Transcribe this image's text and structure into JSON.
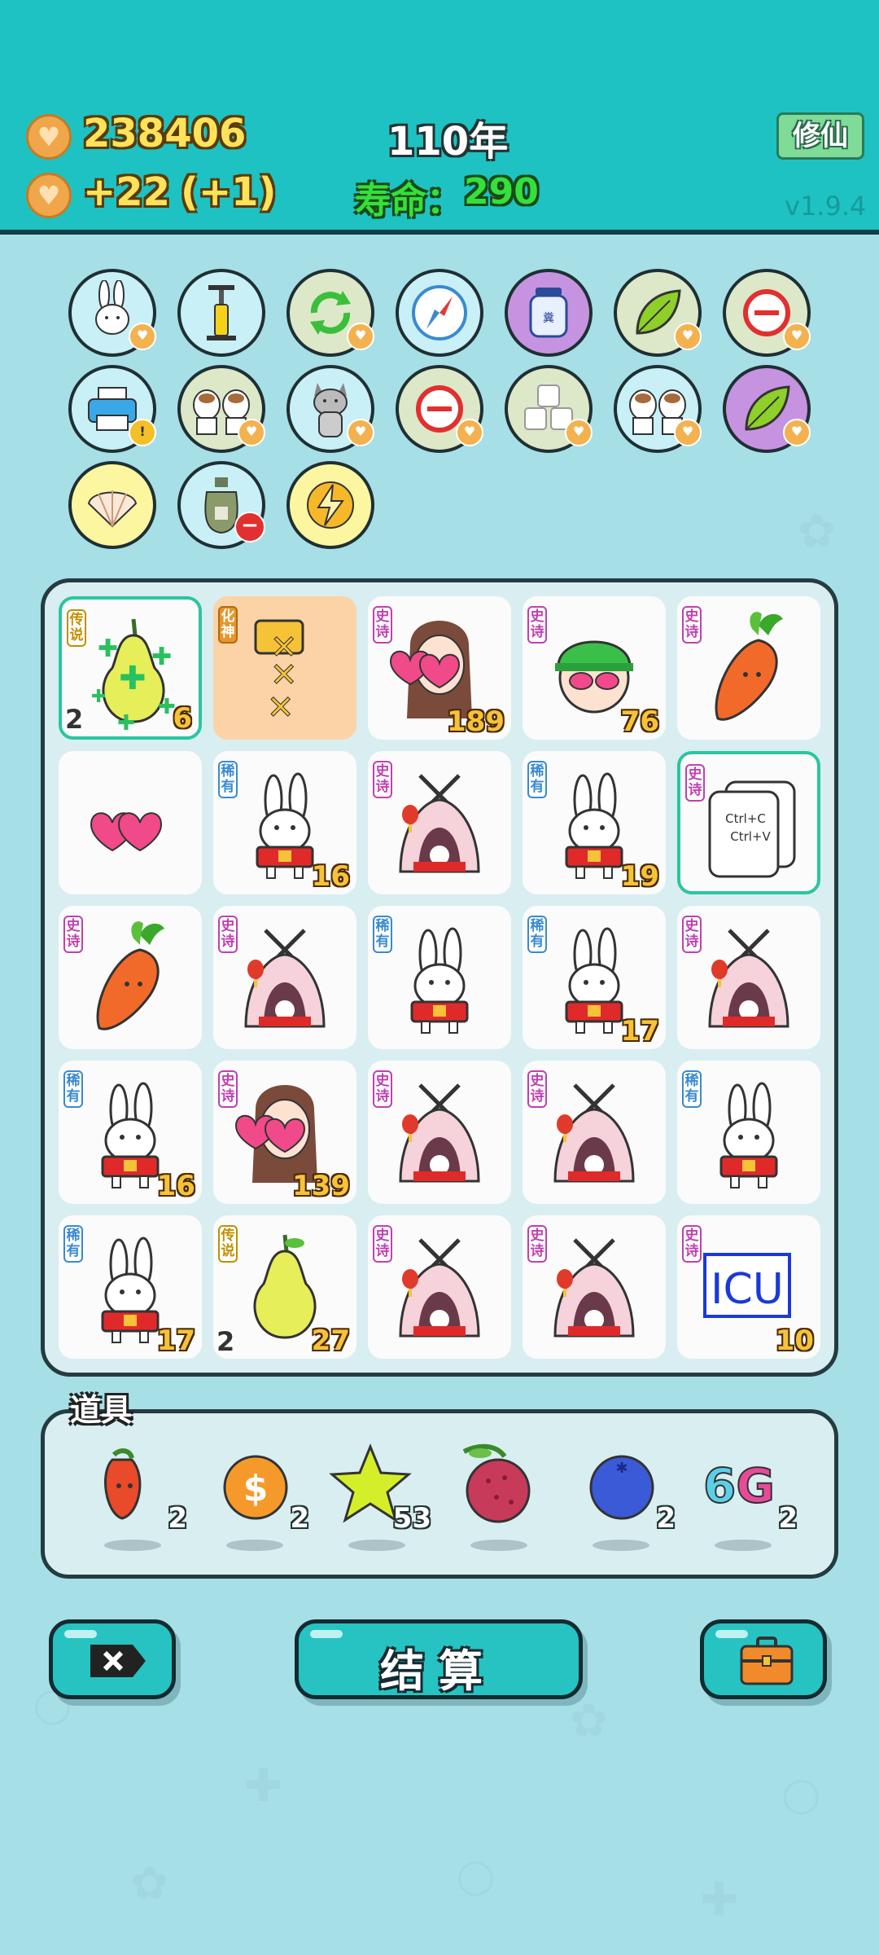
{
  "header": {
    "coins": "238406",
    "income": "+22",
    "income_bonus": "(+1)",
    "year": "110年",
    "lifespan_label": "寿命：",
    "lifespan_value": "290",
    "xiuxian_label": "修仙",
    "version": "v1.9.4"
  },
  "skills": [
    {
      "icon": "rabbit-icon"
    },
    {
      "icon": "air-pump-icon"
    },
    {
      "icon": "refresh-icon"
    },
    {
      "icon": "compass-icon"
    },
    {
      "icon": "jar-icon",
      "jar_label": "糞"
    },
    {
      "icon": "leaf-icon"
    },
    {
      "icon": "minus-circle-icon"
    },
    {
      "icon": "printer-icon"
    },
    {
      "icon": "two-cows-icon"
    },
    {
      "icon": "husky-icon"
    },
    {
      "icon": "minus-circle-icon"
    },
    {
      "icon": "cubes-icon"
    },
    {
      "icon": "two-cows-icon"
    },
    {
      "icon": "leaf-icon"
    },
    {
      "icon": "shell-icon"
    },
    {
      "icon": "sack-icon"
    },
    {
      "icon": "lightning-icon"
    }
  ],
  "board": {
    "rarity_labels": {
      "epic": "史诗",
      "rare": "稀有",
      "legend": "传说",
      "god": "化神"
    },
    "cells": [
      {
        "item": "pear-sparkle",
        "rarity": "legend",
        "left_count": "2",
        "count": "6"
      },
      {
        "item": "golden-slide",
        "rarity": "god",
        "left_count": "",
        "count": ""
      },
      {
        "item": "girl-hearts",
        "rarity": "epic",
        "left_count": "",
        "count": "189"
      },
      {
        "item": "green-hat-face",
        "rarity": "epic",
        "left_count": "",
        "count": "76"
      },
      {
        "item": "carrot",
        "rarity": "epic",
        "left_count": "",
        "count": ""
      },
      {
        "item": "hearts",
        "rarity": "",
        "left_count": "",
        "count": ""
      },
      {
        "item": "rabbit",
        "rarity": "rare",
        "left_count": "",
        "count": "16"
      },
      {
        "item": "tent",
        "rarity": "epic",
        "left_count": "",
        "count": ""
      },
      {
        "item": "rabbit",
        "rarity": "rare",
        "left_count": "",
        "count": "19"
      },
      {
        "item": "ctrlcv",
        "rarity": "epic",
        "left_count": "",
        "count": "",
        "ctrl_c": "Ctrl+C",
        "ctrl_v": "Ctrl+V"
      },
      {
        "item": "carrot",
        "rarity": "epic",
        "left_count": "",
        "count": ""
      },
      {
        "item": "tent",
        "rarity": "epic",
        "left_count": "",
        "count": ""
      },
      {
        "item": "rabbit",
        "rarity": "rare",
        "left_count": "",
        "count": ""
      },
      {
        "item": "rabbit",
        "rarity": "rare",
        "left_count": "",
        "count": "17"
      },
      {
        "item": "tent",
        "rarity": "epic",
        "left_count": "",
        "count": ""
      },
      {
        "item": "rabbit",
        "rarity": "rare",
        "left_count": "",
        "count": "16"
      },
      {
        "item": "girl-hearts",
        "rarity": "epic",
        "left_count": "",
        "count": "139"
      },
      {
        "item": "tent",
        "rarity": "epic",
        "left_count": "",
        "count": ""
      },
      {
        "item": "tent",
        "rarity": "epic",
        "left_count": "",
        "count": ""
      },
      {
        "item": "rabbit",
        "rarity": "rare",
        "left_count": "",
        "count": ""
      },
      {
        "item": "rabbit",
        "rarity": "rare",
        "left_count": "",
        "count": "17"
      },
      {
        "item": "pear",
        "rarity": "legend",
        "left_count": "2",
        "count": "27"
      },
      {
        "item": "tent",
        "rarity": "epic",
        "left_count": "",
        "count": ""
      },
      {
        "item": "tent",
        "rarity": "epic",
        "left_count": "",
        "count": ""
      },
      {
        "item": "icu",
        "rarity": "epic",
        "left_count": "",
        "count": "10",
        "icu_label": "ICU"
      }
    ]
  },
  "props": {
    "title": "道具",
    "items": [
      {
        "icon": "chili-icon",
        "count": "2"
      },
      {
        "icon": "dollar-coin-icon",
        "count": "2"
      },
      {
        "icon": "star-icon",
        "count": "53"
      },
      {
        "icon": "lychee-icon",
        "count": ""
      },
      {
        "icon": "blueberry-icon",
        "count": "2"
      },
      {
        "icon": "6g-icon",
        "count": "2",
        "label_6": "6",
        "label_g": "G"
      }
    ]
  },
  "buttons": {
    "close_icon": "close-x-icon",
    "settle_label": "结算",
    "bag_icon": "briefcase-icon"
  },
  "colors": {
    "header_bg": "#1ec2c2",
    "page_bg": "#a7dfe6",
    "coin_text": "#fde25a",
    "life_text": "#35e03a",
    "button": "#27c3c3"
  }
}
